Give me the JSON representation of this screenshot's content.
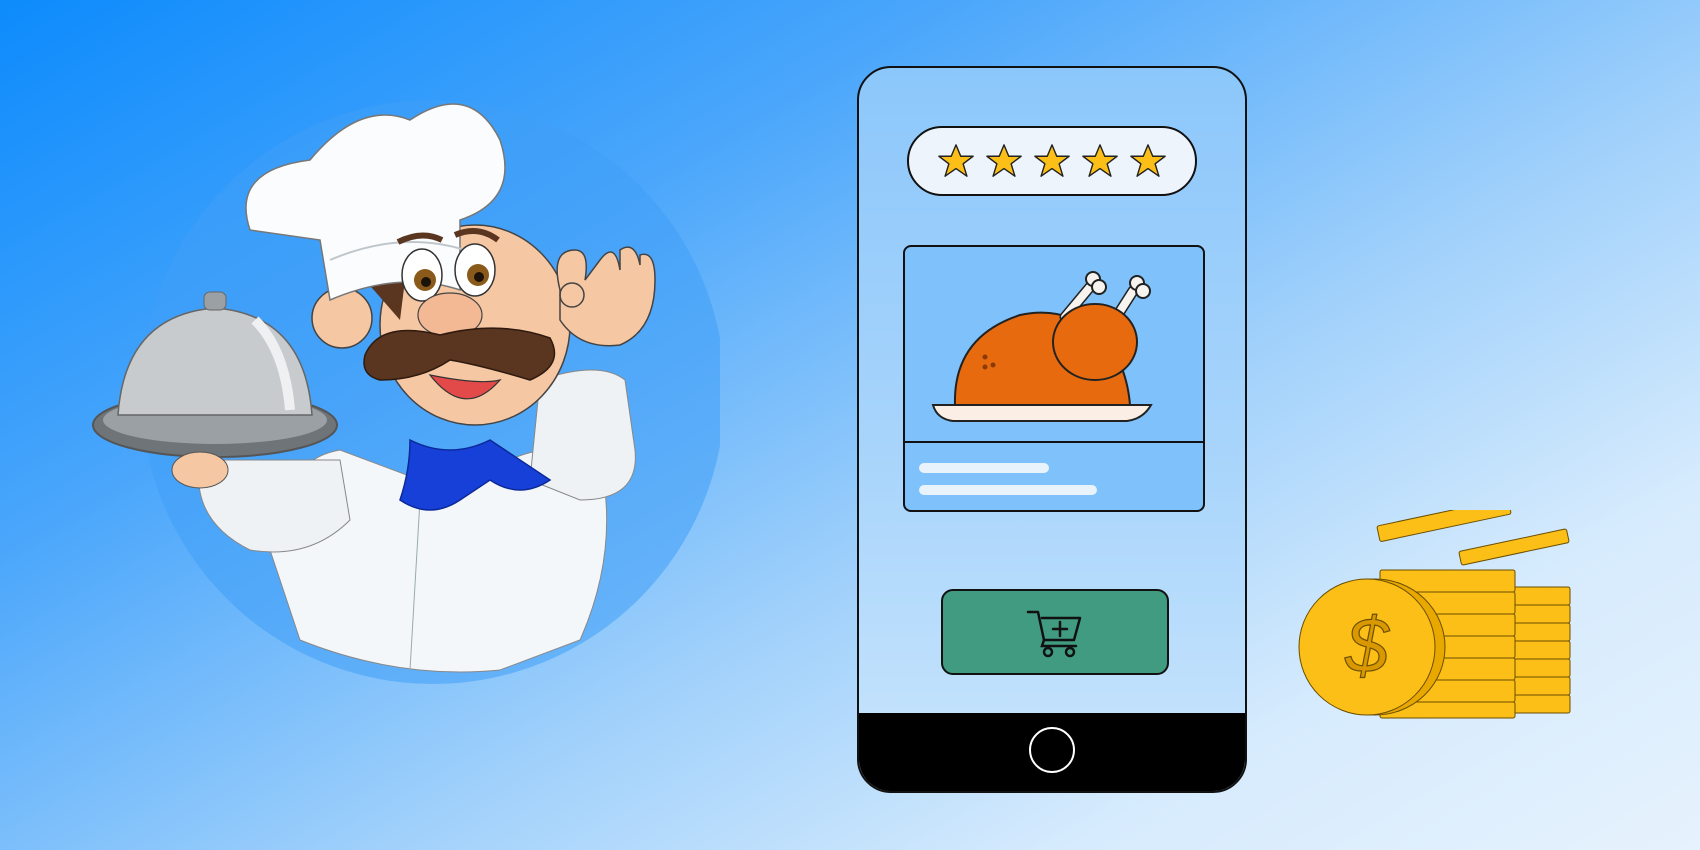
{
  "illustration": {
    "chef": {
      "description_icon": "chef-with-cloche-icon"
    },
    "phone": {
      "rating": {
        "stars": 5,
        "max": 5,
        "icon": "star-icon",
        "color": "#fbbf17"
      },
      "product": {
        "icon": "roast-chicken-icon"
      },
      "cart_button": {
        "icon": "add-to-cart-icon",
        "color": "#419b80"
      },
      "home_button": {
        "icon": "home-button-icon"
      }
    },
    "coins": {
      "icon": "dollar-coin-stack-icon",
      "color": "#fbbf17"
    }
  }
}
